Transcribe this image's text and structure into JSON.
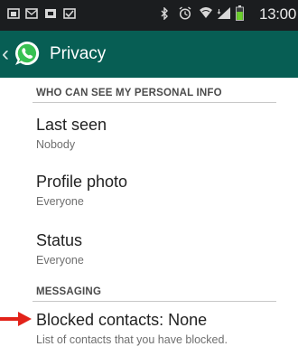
{
  "status_bar": {
    "time": "13:00",
    "notification_icons": [
      "screenshot-icon",
      "mail-icon",
      "image-icon",
      "checkbox-icon"
    ],
    "system_icons": [
      "bluetooth-icon",
      "alarm-icon",
      "wifi-icon",
      "signal-icon",
      "battery-icon"
    ],
    "colors": {
      "background": "#1b1d1f",
      "battery": "#6bcf2c"
    }
  },
  "action_bar": {
    "title": "Privacy",
    "color": "#075e54"
  },
  "sections": [
    {
      "header": "WHO CAN SEE MY PERSONAL INFO"
    },
    {
      "header": "MESSAGING"
    }
  ],
  "items": [
    {
      "title": "Last seen",
      "summary": "Nobody"
    },
    {
      "title": "Profile photo",
      "summary": "Everyone"
    },
    {
      "title": "Status",
      "summary": "Everyone"
    },
    {
      "title": "Blocked contacts: None",
      "summary": "List of contacts that you have blocked."
    }
  ],
  "annotation": {
    "arrow_color": "#e2231a"
  }
}
